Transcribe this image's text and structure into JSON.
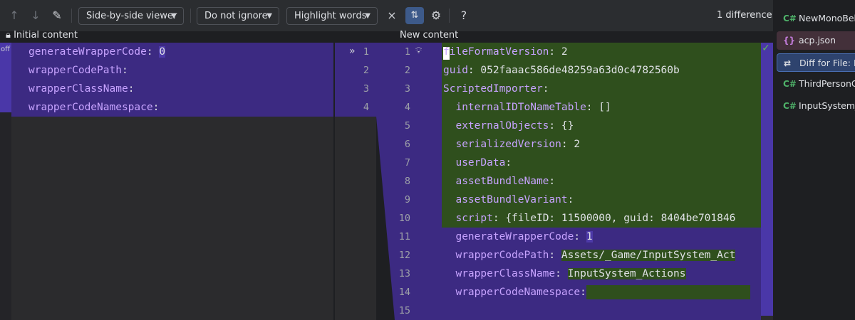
{
  "toolbar": {
    "viewer_label": "Side-by-side viewer",
    "ignore_label": "Do not ignore",
    "highlight_label": "Highlight words",
    "difference_count": "1 difference"
  },
  "left": {
    "header": "Initial content",
    "off_label": "off",
    "lines": [
      {
        "key": "generateWrapperCode",
        "sep": ": ",
        "value": "0"
      },
      {
        "key": "wrapperCodePath",
        "sep": ":",
        "value": ""
      },
      {
        "key": "wrapperClassName",
        "sep": ":",
        "value": ""
      },
      {
        "key": "wrapperCodeNamespace",
        "sep": ":",
        "value": ""
      }
    ],
    "line_numbers": [
      "1",
      "2",
      "3",
      "4"
    ]
  },
  "right": {
    "header": "New content",
    "line_numbers": [
      "1",
      "2",
      "3",
      "4",
      "5",
      "6",
      "7",
      "8",
      "9",
      "10",
      "11",
      "12",
      "13",
      "14",
      "15"
    ],
    "lines": [
      {
        "indent": "",
        "key": "fileFormatVersion",
        "sep": ": ",
        "value": "2"
      },
      {
        "indent": "",
        "key": "guid",
        "sep": ": ",
        "value": "052faaac586de48259a63d0c4782560b"
      },
      {
        "indent": "",
        "key": "ScriptedImporter",
        "sep": ":",
        "value": ""
      },
      {
        "indent": "  ",
        "key": "internalIDToNameTable",
        "sep": ": ",
        "value": "[]"
      },
      {
        "indent": "  ",
        "key": "externalObjects",
        "sep": ": ",
        "value": "{}"
      },
      {
        "indent": "  ",
        "key": "serializedVersion",
        "sep": ": ",
        "value": "2"
      },
      {
        "indent": "  ",
        "key": "userData",
        "sep": ":",
        "value": ""
      },
      {
        "indent": "  ",
        "key": "assetBundleName",
        "sep": ":",
        "value": ""
      },
      {
        "indent": "  ",
        "key": "assetBundleVariant",
        "sep": ":",
        "value": ""
      },
      {
        "indent": "  ",
        "key": "script",
        "sep": ": ",
        "value": "{fileID: 11500000, guid: 8404be701846"
      },
      {
        "indent": "  ",
        "key": "generateWrapperCode",
        "sep": ": ",
        "value": "1"
      },
      {
        "indent": "  ",
        "key": "wrapperCodePath",
        "sep": ": ",
        "value": "Assets/_Game/InputSystem_Act"
      },
      {
        "indent": "  ",
        "key": "wrapperClassName",
        "sep": ": ",
        "value": "InputSystem_Actions"
      },
      {
        "indent": "  ",
        "key": "wrapperCodeNamespace",
        "sep": ":",
        "value": ""
      },
      {
        "indent": "",
        "key": "",
        "sep": "",
        "value": ""
      }
    ]
  },
  "sidebar": {
    "items": [
      {
        "icon": "C#",
        "label": "NewMonoBehaviour"
      },
      {
        "icon": "{}",
        "label": "acp.json"
      },
      {
        "icon": "⇄",
        "label": "Diff for File: Input"
      },
      {
        "icon": "C#",
        "label": "ThirdPersonController"
      },
      {
        "icon": "C#",
        "label": "InputSystem_Actions"
      }
    ]
  },
  "colors": {
    "added": "#2f4f1d",
    "changed": "#3c2a82",
    "accent": "#3d5a8a"
  }
}
